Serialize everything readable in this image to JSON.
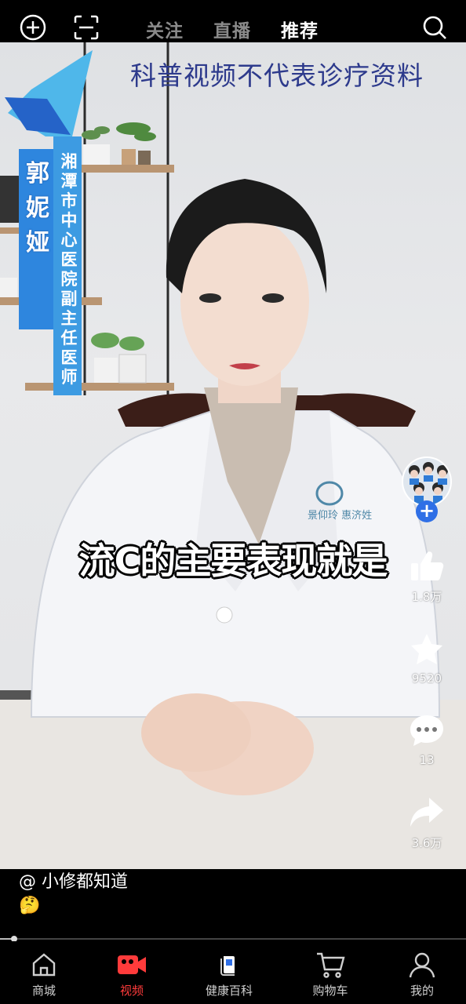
{
  "header": {
    "tabs": [
      {
        "label": "关注",
        "active": false
      },
      {
        "label": "直播",
        "active": false
      },
      {
        "label": "推荐",
        "active": true
      }
    ]
  },
  "video": {
    "disclaimer": "科普视频不代表诊疗资料",
    "doctor_name": "郭妮娅",
    "doctor_title": "湘潭市中心医院副主任医师",
    "subtitle": "流C的主要表现就是",
    "coat_badge_text": "景仰玲 惠济姓"
  },
  "actions": {
    "like_count": "1.8万",
    "favorite_count": "9520",
    "comment_count": "13",
    "share_count": "3.6万"
  },
  "caption": {
    "author": "@ 小修都知道",
    "emoji": "🤔"
  },
  "playback": {
    "progress": 0.03
  },
  "bottom_nav": {
    "items": [
      {
        "label": "商城",
        "icon": "home-icon",
        "active": false
      },
      {
        "label": "视频",
        "icon": "video-icon",
        "active": true
      },
      {
        "label": "健康百科",
        "icon": "book-icon",
        "active": false
      },
      {
        "label": "购物车",
        "icon": "cart-icon",
        "active": false
      },
      {
        "label": "我的",
        "icon": "person-icon",
        "active": false
      }
    ]
  },
  "colors": {
    "accent_red": "#ff3b3b",
    "follow_blue": "#2f6fe6",
    "banner_blue": "#2e86de",
    "disclaimer_blue": "#2d3a8c"
  }
}
